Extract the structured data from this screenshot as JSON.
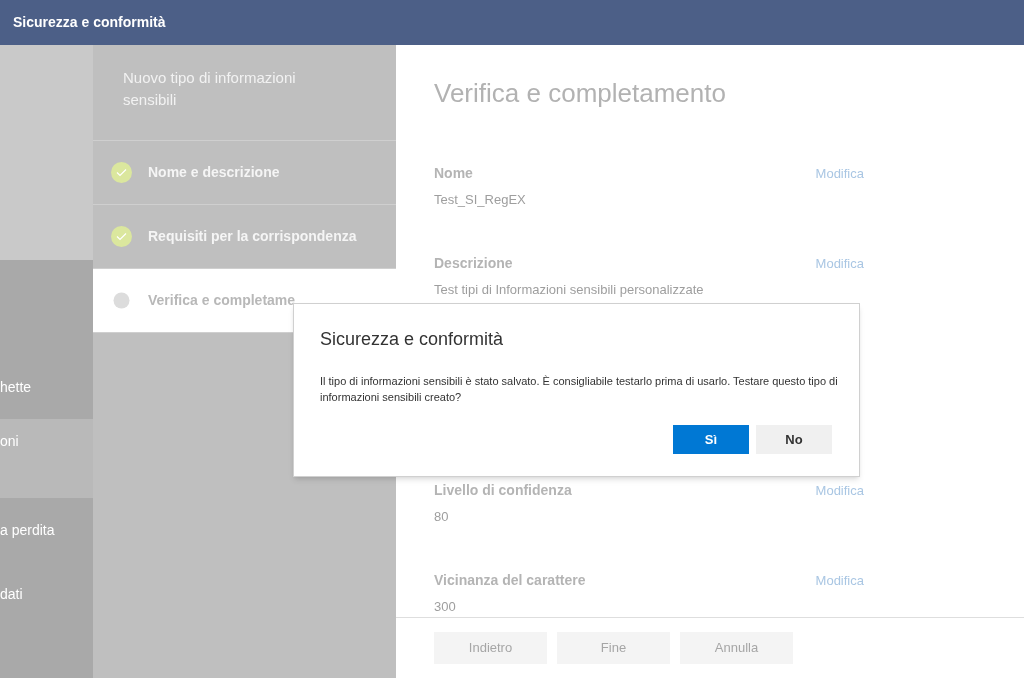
{
  "header": {
    "title": "Sicurezza e conformità"
  },
  "nav": {
    "items": [
      {
        "label": "hette",
        "selected": false
      },
      {
        "label": "oni",
        "selected": true
      },
      {
        "label": "a perdita",
        "selected": false
      },
      {
        "label": "dati",
        "selected": false
      }
    ]
  },
  "wizard": {
    "title": "Nuovo tipo di informazioni sensibili",
    "steps": [
      {
        "label": "Nome e descrizione",
        "completed": true,
        "selected": false
      },
      {
        "label": "Requisiti per la corrispondenza",
        "completed": true,
        "selected": false
      },
      {
        "label": "Verifica e completame",
        "completed": false,
        "selected": true
      }
    ]
  },
  "page": {
    "title": "Verifica e completamento",
    "sections": [
      {
        "label": "Nome",
        "value": "Test_SI_RegEX",
        "action": "Modifica",
        "kind": "top"
      },
      {
        "label": "Descrizione",
        "value": "Test tipi di Informazioni sensibili personalizzate",
        "action": "Modifica",
        "kind": "top"
      },
      {
        "label": "Livello di confidenza",
        "value": "80",
        "action": "Modifica",
        "kind": "bottom"
      },
      {
        "label": "Vicinanza del carattere",
        "value": "300",
        "action": "Modifica",
        "kind": "bottom"
      }
    ],
    "footer_buttons": [
      {
        "label": "Indietro",
        "disabled": true
      },
      {
        "label": "Fine",
        "disabled": true
      },
      {
        "label": "Annulla",
        "disabled": true
      }
    ]
  },
  "dialog": {
    "title": "Sicurezza e conformità",
    "message": "Il tipo di informazioni sensibili è stato salvato. È consigliabile testarlo prima di usarlo. Testare questo tipo di informazioni sensibili creato?",
    "buttons": [
      {
        "label": "Sì",
        "kind": "primary"
      },
      {
        "label": "No",
        "kind": "secondary"
      }
    ]
  }
}
